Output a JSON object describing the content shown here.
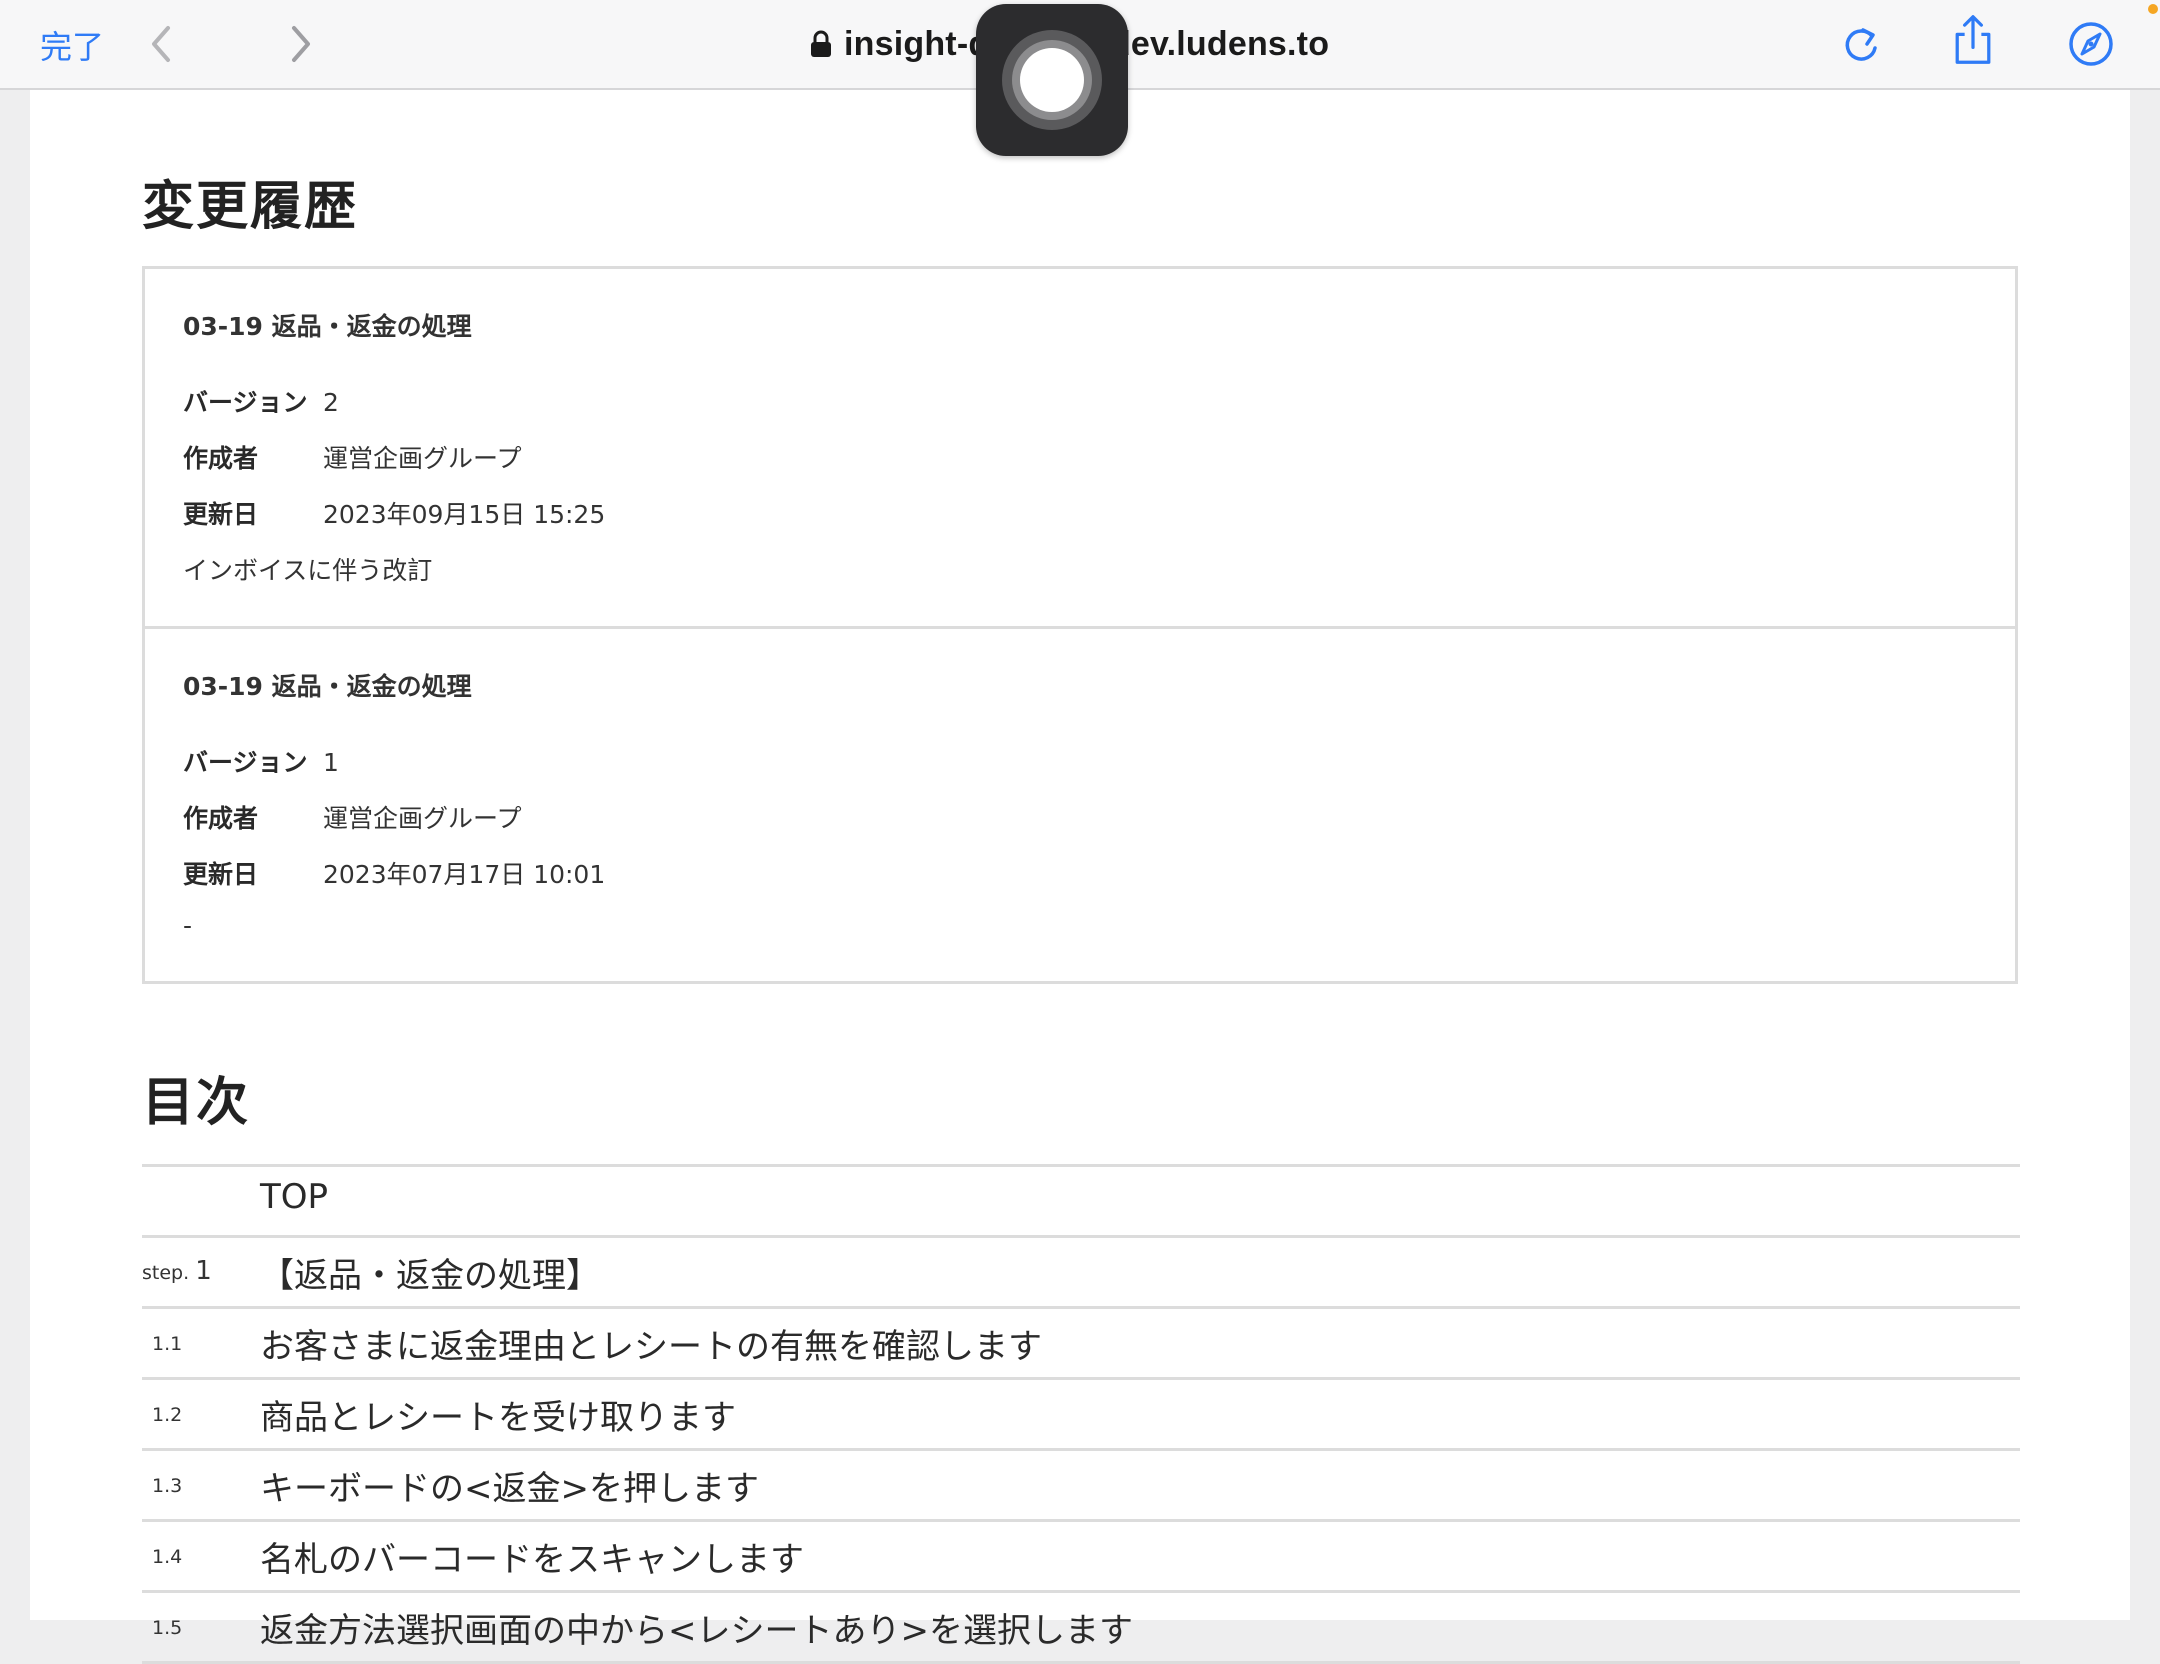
{
  "browser": {
    "done_label": "完了",
    "url": "insight-data.bcl-dev.ludens.to",
    "icons": [
      "chevron-left-icon",
      "chevron-right-icon",
      "lock-icon",
      "reload-icon",
      "share-icon",
      "compass-icon"
    ]
  },
  "history": {
    "heading": "変更履歴",
    "entries": [
      {
        "title": "03-19 返品・返金の処理",
        "version_label": "バージョン",
        "version": "2",
        "author_label": "作成者",
        "author": "運営企画グループ",
        "updated_label": "更新日",
        "updated": "2023年09月15日 15:25",
        "note": "インボイスに伴う改訂"
      },
      {
        "title": "03-19 返品・返金の処理",
        "version_label": "バージョン",
        "version": "1",
        "author_label": "作成者",
        "author": "運営企画グループ",
        "updated_label": "更新日",
        "updated": "2023年07月17日 10:01",
        "note": "-"
      }
    ]
  },
  "toc": {
    "heading": "目次",
    "items": [
      {
        "num": "",
        "text": "TOP"
      },
      {
        "step_prefix": "step.",
        "num": "1",
        "text": "【返品・返金の処理】"
      },
      {
        "num": "1.1",
        "text": "お客さまに返金理由とレシートの有無を確認します"
      },
      {
        "num": "1.2",
        "text": "商品とレシートを受け取ります"
      },
      {
        "num": "1.3",
        "text": "キーボードの<返金>を押します"
      },
      {
        "num": "1.4",
        "text": "名札のバーコードをスキャンします"
      },
      {
        "num": "1.5",
        "text": "返金方法選択画面の中から<レシートあり>を選択します"
      }
    ]
  }
}
